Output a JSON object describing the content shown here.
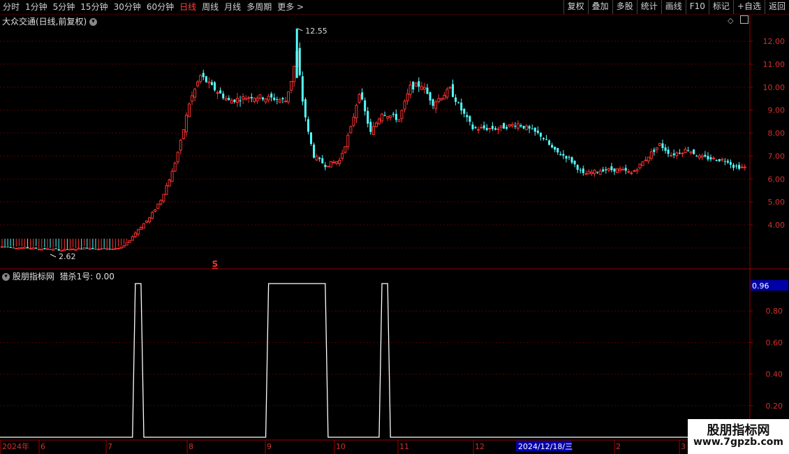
{
  "toolbar": {
    "periods": [
      "分时",
      "1分钟",
      "5分钟",
      "15分钟",
      "30分钟",
      "60分钟",
      "日线",
      "周线",
      "月线",
      "多周期",
      "更多 >"
    ],
    "active_period": "日线",
    "actions": [
      "复权",
      "叠加",
      "多股",
      "统计",
      "画线",
      "F10",
      "标记",
      "+自选",
      "返回"
    ]
  },
  "main_panel": {
    "title": "大众交通(日线,前复权)",
    "y_ticks": [
      "12.00",
      "11.00",
      "10.00",
      "9.00",
      "8.00",
      "7.00",
      "6.00",
      "5.00",
      "4.00"
    ],
    "high_label": "12.55",
    "low_label": "2.62",
    "signal_marker": "S"
  },
  "indicator_panel": {
    "title": "股朋指标网",
    "value_label": "猎杀1号: 0.00",
    "current_value": "0.96",
    "y_ticks": [
      "0.80",
      "0.60",
      "0.40",
      "0.20"
    ]
  },
  "x_axis": {
    "labels": [
      "2024年",
      "6",
      "7",
      "8",
      "9",
      "10",
      "11",
      "12",
      "2",
      "3"
    ],
    "cursor_date": "2024/12/18/三"
  },
  "watermark": {
    "line1": "股朋指标网",
    "line2": "www.7gpzb.com"
  },
  "colors": {
    "up": "#ff3232",
    "down": "#54ffff",
    "line": "#ffffff",
    "grid": "#5a0000",
    "axis_text": "#d03030"
  },
  "chart_data": [
    {
      "type": "candlestick",
      "title": "大众交通(日线,前复权)",
      "ylim": [
        3.4,
        12.7
      ],
      "max_price": 12.55,
      "min_price": 2.62,
      "anchors": [
        [
          0,
          3.05
        ],
        [
          15,
          2.95
        ],
        [
          22,
          2.9
        ],
        [
          30,
          3.0
        ],
        [
          34,
          2.95
        ],
        [
          38,
          2.95
        ],
        [
          42,
          3.0
        ],
        [
          44,
          3.2
        ],
        [
          48,
          3.8
        ],
        [
          52,
          4.3
        ],
        [
          56,
          5.1
        ],
        [
          60,
          6.3
        ],
        [
          63,
          7.6
        ],
        [
          66,
          9.3
        ],
        [
          70,
          10.5
        ],
        [
          74,
          10.0
        ],
        [
          80,
          9.4
        ],
        [
          88,
          9.6
        ],
        [
          96,
          9.5
        ],
        [
          100,
          9.4
        ],
        [
          102,
          10.3
        ],
        [
          104,
          11.5
        ],
        [
          106,
          9.4
        ],
        [
          108,
          8.0
        ],
        [
          110,
          7.0
        ],
        [
          114,
          6.6
        ],
        [
          119,
          6.8
        ],
        [
          123,
          8.2
        ],
        [
          126,
          9.8
        ],
        [
          130,
          8.0
        ],
        [
          134,
          8.9
        ],
        [
          140,
          8.6
        ],
        [
          144,
          10.0
        ],
        [
          148,
          10.1
        ],
        [
          152,
          9.3
        ],
        [
          158,
          9.9
        ],
        [
          162,
          9.0
        ],
        [
          166,
          8.2
        ],
        [
          175,
          8.2
        ],
        [
          182,
          8.4
        ],
        [
          190,
          7.9
        ],
        [
          195,
          7.2
        ],
        [
          200,
          6.9
        ],
        [
          205,
          6.2
        ],
        [
          212,
          6.4
        ],
        [
          218,
          6.4
        ],
        [
          222,
          6.25
        ],
        [
          225,
          6.6
        ],
        [
          228,
          7.0
        ],
        [
          232,
          7.5
        ],
        [
          236,
          7.05
        ],
        [
          242,
          7.3
        ],
        [
          246,
          6.95
        ],
        [
          252,
          6.85
        ],
        [
          256,
          6.8
        ],
        [
          258,
          6.55
        ],
        [
          262,
          6.5
        ]
      ]
    },
    {
      "type": "line",
      "title": "猎杀1号",
      "ylim": [
        0,
        1
      ],
      "levels": [
        0,
        1
      ],
      "pulses": [
        [
          46,
          50
        ],
        [
          93,
          115
        ],
        [
          133,
          137
        ]
      ],
      "ramp_bars": 1
    }
  ]
}
